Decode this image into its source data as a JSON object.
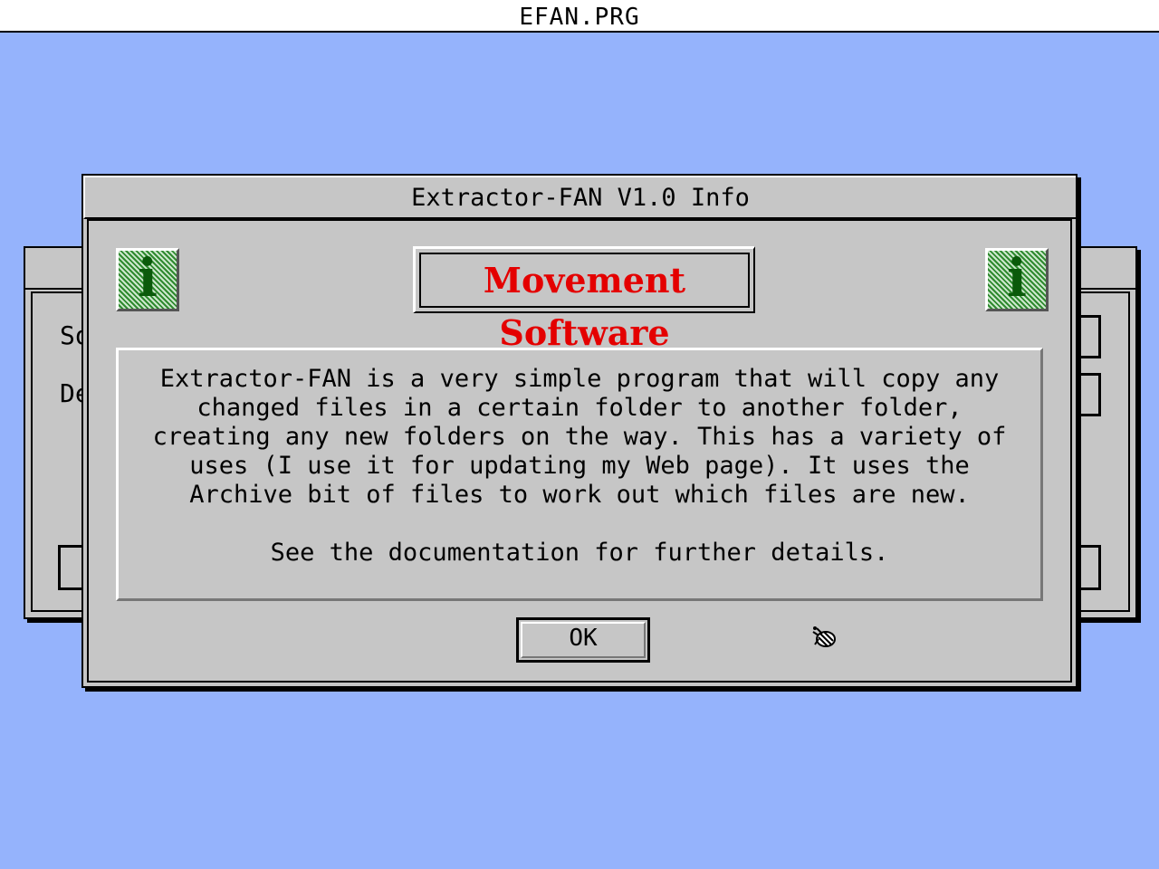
{
  "menubar": {
    "title": "EFAN.PRG"
  },
  "background_window": {
    "label_1": "So",
    "label_2": "De"
  },
  "dialog": {
    "title": "Extractor-FAN V1.0 Info",
    "left_icon": "i",
    "right_icon": "i",
    "brand": "Movement Software",
    "description_lines": [
      "Extractor-FAN is a very simple program that will copy any",
      "changed files in a certain folder to another folder,",
      "creating any new folders on the way. This has a variety of",
      "uses (I use it for updating my Web page). It uses the",
      "Archive bit of files to work out which files are new."
    ],
    "footer_line": "See the documentation for further details.",
    "ok_label": "OK",
    "busy_icon": "bee-cursor-icon"
  },
  "colors": {
    "desktop": "#95b3fc",
    "window": "#c6c6c6",
    "brand_text": "#e40000",
    "info_icon": "#2f8a2f"
  }
}
